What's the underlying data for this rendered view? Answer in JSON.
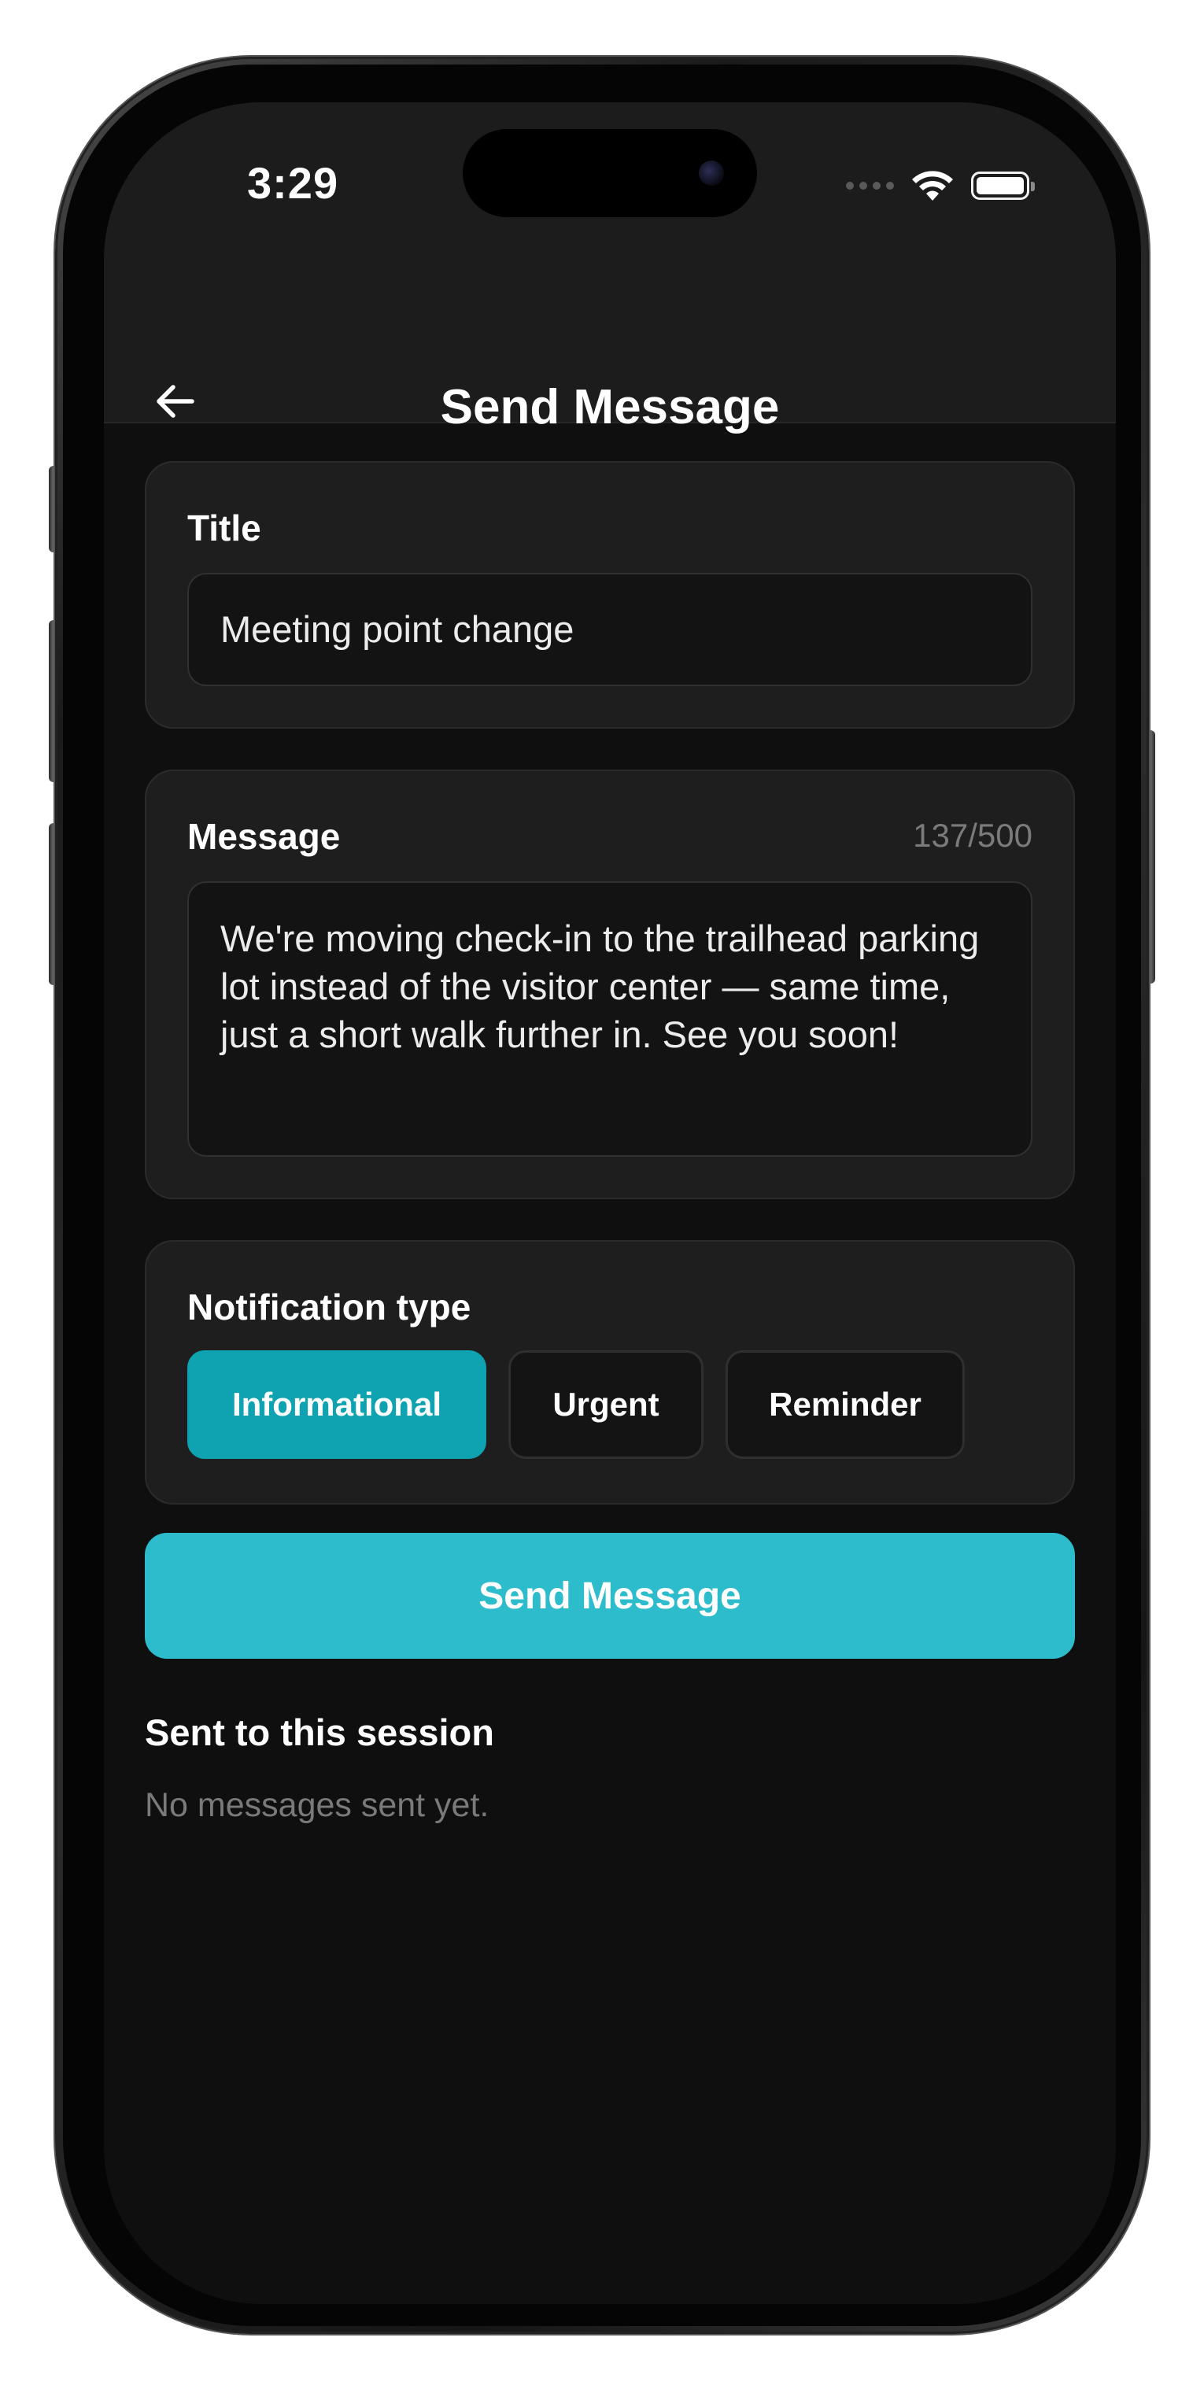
{
  "status_bar": {
    "time": "3:29"
  },
  "header": {
    "title": "Send Message"
  },
  "title_card": {
    "label": "Title",
    "value": "Meeting point change"
  },
  "message_card": {
    "label": "Message",
    "counter": "137/500",
    "value": "We're moving check-in to the trailhead parking lot instead of the visitor center — same time, just a short walk further in. See you soon!"
  },
  "notification_card": {
    "label": "Notification type",
    "options": [
      "Informational",
      "Urgent",
      "Reminder"
    ],
    "selected": "Informational"
  },
  "send_button": {
    "label": "Send Message"
  },
  "sent_section": {
    "title": "Sent to this session",
    "empty_text": "No messages sent yet."
  },
  "colors": {
    "accent": "#2dbccb",
    "selected_chip": "#0fa2b0",
    "background": "#0f0f0f",
    "card": "#1e1e1e"
  },
  "icons": {
    "back": "arrow-left-icon",
    "wifi": "wifi-icon",
    "battery": "battery-icon",
    "signal": "signal-dots-icon"
  }
}
